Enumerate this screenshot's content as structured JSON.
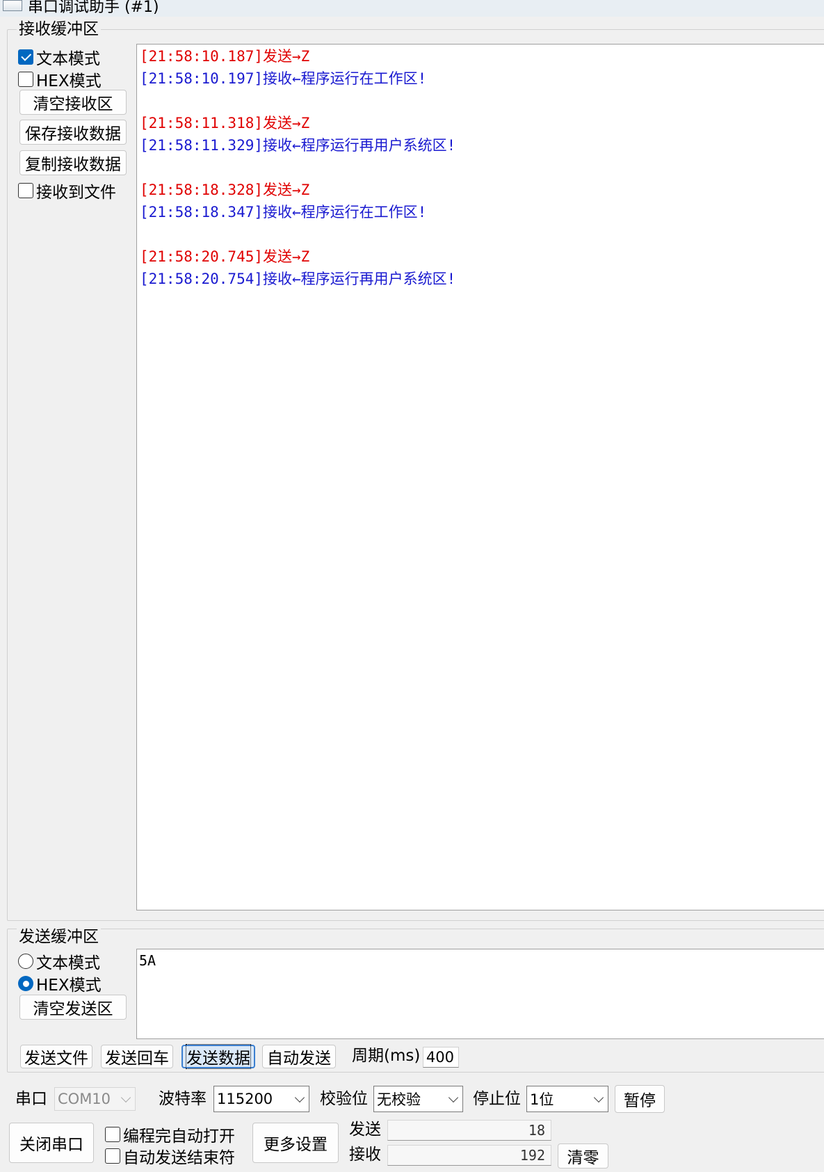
{
  "window": {
    "title": "串口调试助手 (#1)"
  },
  "receive": {
    "legend": "接收缓冲区",
    "text_mode": {
      "label": "文本模式",
      "checked": true
    },
    "hex_mode": {
      "label": "HEX模式",
      "checked": false
    },
    "clear_button": "清空接收区",
    "save_button": "保存接收数据",
    "copy_button": "复制接收数据",
    "to_file": {
      "label": "接收到文件",
      "checked": false
    },
    "lines": [
      {
        "type": "sent",
        "text": "[21:58:10.187]发送→Z"
      },
      {
        "type": "recv",
        "text": "[21:58:10.197]接收←程序运行在工作区!"
      },
      {
        "type": "sent",
        "text": "[21:58:11.318]发送→Z"
      },
      {
        "type": "recv",
        "text": "[21:58:11.329]接收←程序运行再用户系统区!"
      },
      {
        "type": "sent",
        "text": "[21:58:18.328]发送→Z"
      },
      {
        "type": "recv",
        "text": "[21:58:18.347]接收←程序运行在工作区!"
      },
      {
        "type": "sent",
        "text": "[21:58:20.745]发送→Z"
      },
      {
        "type": "recv",
        "text": "[21:58:20.754]接收←程序运行再用户系统区!"
      }
    ]
  },
  "send": {
    "legend": "发送缓冲区",
    "text_mode": {
      "label": "文本模式",
      "selected": false
    },
    "hex_mode": {
      "label": "HEX模式",
      "selected": true
    },
    "clear_button": "清空发送区",
    "content": "5A",
    "send_file_button": "发送文件",
    "send_enter_button": "发送回车",
    "send_data_button": "发送数据",
    "auto_send_button": "自动发送",
    "period_label": "周期(ms)",
    "period_value": "400"
  },
  "port": {
    "port_label": "串口",
    "port_value": "COM10",
    "baud_label": "波特率",
    "baud_value": "115200",
    "parity_label": "校验位",
    "parity_value": "无校验",
    "stop_label": "停止位",
    "stop_value": "1位",
    "pause_button": "暂停",
    "close_button": "关闭串口",
    "auto_open": {
      "label": "编程完自动打开",
      "checked": false
    },
    "auto_end": {
      "label": "自动发送结束符",
      "checked": false
    },
    "more_button": "更多设置",
    "sent_label": "发送",
    "sent_count": "18",
    "recv_label": "接收",
    "recv_count": "192",
    "reset_button": "清零"
  }
}
